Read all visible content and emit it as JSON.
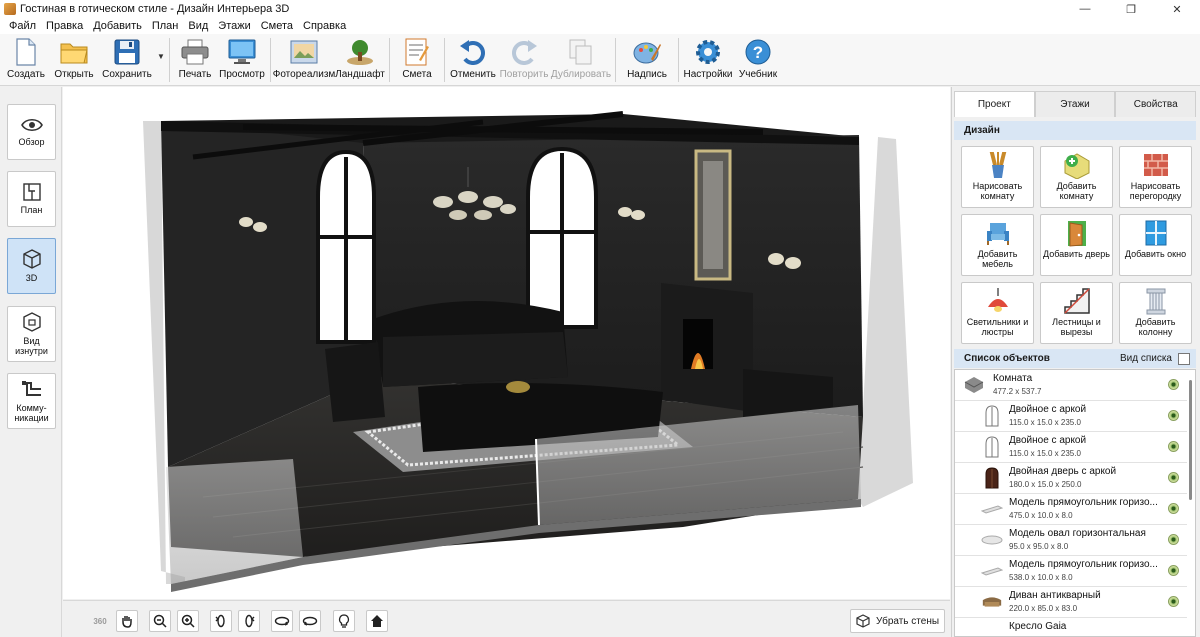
{
  "window": {
    "title": "Гостиная в готическом стиле - Дизайн Интерьера 3D",
    "controls": {
      "minimize": "—",
      "maximize": "❐",
      "close": "✕"
    }
  },
  "menu": [
    "Файл",
    "Правка",
    "Добавить",
    "План",
    "Вид",
    "Этажи",
    "Смета",
    "Справка"
  ],
  "toolbar": {
    "create": "Создать",
    "open": "Открыть",
    "save": "Сохранить",
    "save_dropdown": "▼",
    "print": "Печать",
    "preview": "Просмотр",
    "photorealism": "Фотореализм",
    "landscape": "Ландшафт",
    "estimate": "Смета",
    "undo": "Отменить",
    "redo": "Повторить",
    "duplicate": "Дублировать",
    "caption": "Надпись",
    "settings": "Настройки",
    "tutorial": "Учебник"
  },
  "left_views": [
    {
      "label": "Обзор",
      "icon": "eye-icon",
      "active": false
    },
    {
      "label": "План",
      "icon": "plan-icon",
      "active": false
    },
    {
      "label": "3D",
      "icon": "cube-icon",
      "active": true
    },
    {
      "label": "Вид изнутри",
      "icon": "inside-view-icon",
      "active": false
    },
    {
      "label": "Комму-никации",
      "icon": "pipes-icon",
      "active": false
    }
  ],
  "bottom": {
    "remove_walls": "Убрать стены",
    "rotate_360": "360"
  },
  "right": {
    "tabs": [
      "Проект",
      "Этажи",
      "Свойства"
    ],
    "active_tab": "Проект",
    "design_header": "Дизайн",
    "design_buttons": [
      "Нарисовать комнату",
      "Добавить комнату",
      "Нарисовать перегородку",
      "Добавить мебель",
      "Добавить дверь",
      "Добавить окно",
      "Светильники и люстры",
      "Лестницы и вырезы",
      "Добавить колонну"
    ],
    "objects_header": "Список объектов",
    "objects_view": "Вид списка",
    "objects": [
      {
        "name": "Комната",
        "dims": "477.2 x 537.7"
      },
      {
        "name": "Двойное с аркой",
        "dims": "115.0 x 15.0 x 235.0"
      },
      {
        "name": "Двойное с аркой",
        "dims": "115.0 x 15.0 x 235.0"
      },
      {
        "name": "Двойная дверь с аркой",
        "dims": "180.0 x 15.0 x 250.0"
      },
      {
        "name": "Модель прямоугольник горизо...",
        "dims": "475.0 x 10.0 x 8.0"
      },
      {
        "name": "Модель овал горизонтальная",
        "dims": "95.0 x 95.0 x 8.0"
      },
      {
        "name": "Модель прямоугольник горизо...",
        "dims": "538.0 x 10.0 x 8.0"
      },
      {
        "name": "Диван антикварный",
        "dims": "220.0 x 85.0 x 83.0"
      },
      {
        "name": "Кресло Gaia",
        "dims": ""
      }
    ]
  }
}
